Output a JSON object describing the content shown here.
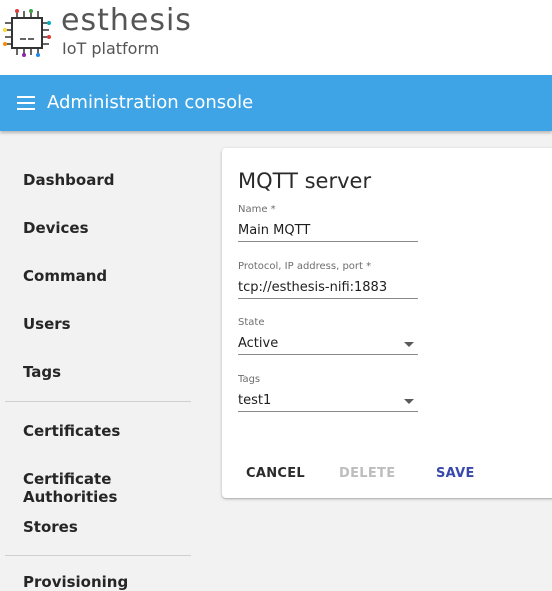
{
  "brand": {
    "title": "esthesis",
    "subtitle": "IoT platform"
  },
  "appbar": {
    "title": "Administration console",
    "menu_icon": "hamburger-menu-icon"
  },
  "sidebar": {
    "items": [
      {
        "label": "Dashboard"
      },
      {
        "label": "Devices"
      },
      {
        "label": "Command"
      },
      {
        "label": "Users"
      },
      {
        "label": "Tags"
      },
      {
        "label": "Certificates"
      },
      {
        "label": "Certificate Authorities"
      },
      {
        "label": "Stores"
      },
      {
        "label": "Provisioning"
      }
    ]
  },
  "form": {
    "title": "MQTT server",
    "name": {
      "label": "Name *",
      "value": "Main MQTT"
    },
    "address": {
      "label": "Protocol, IP address, port *",
      "value": "tcp://esthesis-nifi:1883"
    },
    "state": {
      "label": "State",
      "value": "Active"
    },
    "tags": {
      "label": "Tags",
      "value": "test1"
    },
    "buttons": {
      "cancel": "CANCEL",
      "delete": "DELETE",
      "save": "SAVE"
    }
  },
  "colors": {
    "appbar": "#3fa4e6",
    "save_button": "#3949ab",
    "disabled_button": "#bdbdbd",
    "background": "#f2f2f2"
  }
}
